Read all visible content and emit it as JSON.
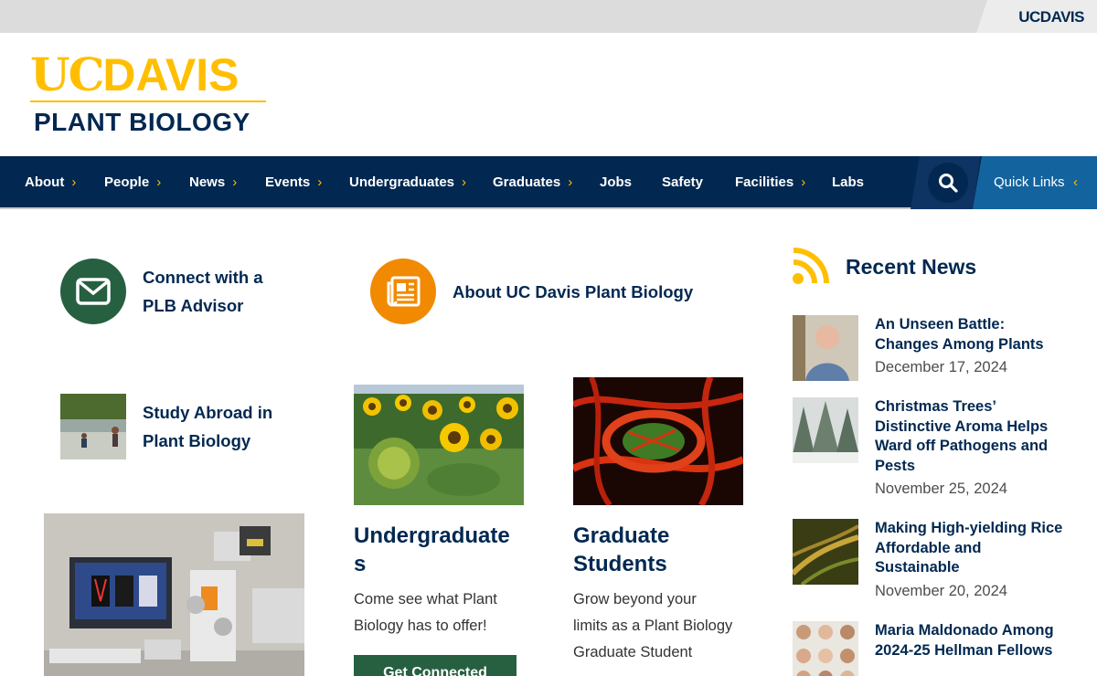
{
  "utility_bar": {
    "brand": "UCDAVIS"
  },
  "logo": {
    "uc": "UC",
    "davis": "DAVIS",
    "department": "PLANT BIOLOGY"
  },
  "nav": {
    "items": [
      {
        "label": "About",
        "has_menu": true
      },
      {
        "label": "People",
        "has_menu": true
      },
      {
        "label": "News",
        "has_menu": true
      },
      {
        "label": "Events",
        "has_menu": true
      },
      {
        "label": "Undergraduates",
        "has_menu": true
      },
      {
        "label": "Graduates",
        "has_menu": true
      },
      {
        "label": "Jobs",
        "has_menu": false
      },
      {
        "label": "Safety",
        "has_menu": false
      },
      {
        "label": "Facilities",
        "has_menu": true
      },
      {
        "label": "Labs",
        "has_menu": false
      }
    ],
    "chevron": "›",
    "quick_links": "Quick Links",
    "quick_chevron": "‹"
  },
  "callouts": {
    "advisor": {
      "line1": "Connect with a",
      "line2": "PLB Advisor",
      "icon": "envelope-icon",
      "color": "#266041"
    },
    "about": {
      "label": "About UC Davis Plant Biology",
      "icon": "newspaper-icon",
      "color": "#f18a00"
    },
    "abroad": {
      "line1": "Study Abroad in",
      "line2": "Plant Biology"
    }
  },
  "cards": {
    "undergrad": {
      "title1": "Undergraduate",
      "title2": "s",
      "body1": "Come see what Plant",
      "body2": "Biology has to offer!",
      "button": "Get Connected"
    },
    "grad": {
      "title1": "Graduate",
      "title2": "Students",
      "body1": "Grow beyond your",
      "body2": "limits as a Plant Biology",
      "body3": "Graduate Student"
    }
  },
  "recent_news": {
    "title": "Recent News",
    "items": [
      {
        "title": "An Unseen Battle: Changes Among Plants",
        "date": "December 17, 2024"
      },
      {
        "title": "Christmas Trees’ Distinctive Aroma Helps Ward off Pathogens and Pests",
        "date": "November 25, 2024"
      },
      {
        "title": "Making High-yielding Rice Affordable and Sustainable",
        "date": "November 20, 2024"
      },
      {
        "title": "Maria Maldonado Among 2024-25 Hellman Fellows",
        "date": ""
      }
    ]
  },
  "colors": {
    "navy": "#022851",
    "gold": "#ffbf00",
    "blue": "#13639e",
    "green": "#266041",
    "orange": "#f18a00"
  }
}
